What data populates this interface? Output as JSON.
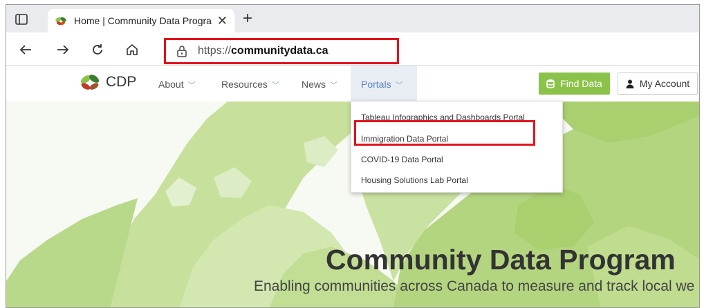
{
  "browser": {
    "tab_title": "Home | Community Data Progra",
    "address_prefix": "https://",
    "address_host": "communitydata.ca"
  },
  "site": {
    "logo_text": "CDP",
    "menu": {
      "about": "About",
      "resources": "Resources",
      "news": "News",
      "portals": "Portals"
    },
    "find_data": "Find Data",
    "my_account": "My Account"
  },
  "dropdown": {
    "items": [
      "Tableau Infographics and Dashboards Portal",
      "Immigration Data Portal",
      "COVID-19 Data Portal",
      "Housing Solutions Lab Portal"
    ]
  },
  "hero": {
    "title": "Community Data Program",
    "subtitle": "Enabling communities across Canada to measure and track local we"
  },
  "colors": {
    "highlight": "#e0141b",
    "find_data_bg": "#8bc34a",
    "map_green": "#b9d98a",
    "active_menu": "#5b84c4"
  },
  "icons": [
    "sidebar-icon",
    "plant-icon",
    "close-icon",
    "plus-icon",
    "back-icon",
    "forward-icon",
    "refresh-icon",
    "home-icon",
    "lock-icon",
    "chevron-down-icon",
    "database-icon",
    "user-icon"
  ]
}
